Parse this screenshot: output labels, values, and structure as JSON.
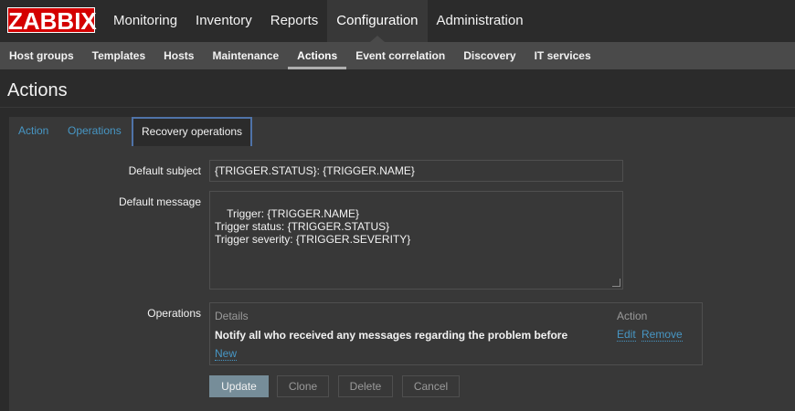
{
  "logo": "ZABBIX",
  "main_menu": [
    "Monitoring",
    "Inventory",
    "Reports",
    "Configuration",
    "Administration"
  ],
  "sub_menu": [
    "Host groups",
    "Templates",
    "Hosts",
    "Maintenance",
    "Actions",
    "Event correlation",
    "Discovery",
    "IT services"
  ],
  "page_title": "Actions",
  "tabs": [
    "Action",
    "Operations",
    "Recovery operations"
  ],
  "form": {
    "subject_label": "Default subject",
    "subject_value": "{TRIGGER.STATUS}: {TRIGGER.NAME}",
    "message_label": "Default message",
    "message_value": "Trigger: {TRIGGER.NAME}\nTrigger status: {TRIGGER.STATUS}\nTrigger severity: {TRIGGER.SEVERITY}",
    "operations_label": "Operations",
    "operations_table": {
      "col_details": "Details",
      "col_action": "Action",
      "row_details": "Notify all who received any messages regarding the problem before",
      "edit": "Edit",
      "remove": "Remove",
      "new": "New"
    }
  },
  "buttons": {
    "update": "Update",
    "clone": "Clone",
    "delete": "Delete",
    "cancel": "Cancel"
  },
  "colors": {
    "logo_red": "#d40000",
    "link_blue": "#4796c4",
    "tab_active_border": "#4f73a8",
    "primary_button": "#768d99"
  }
}
